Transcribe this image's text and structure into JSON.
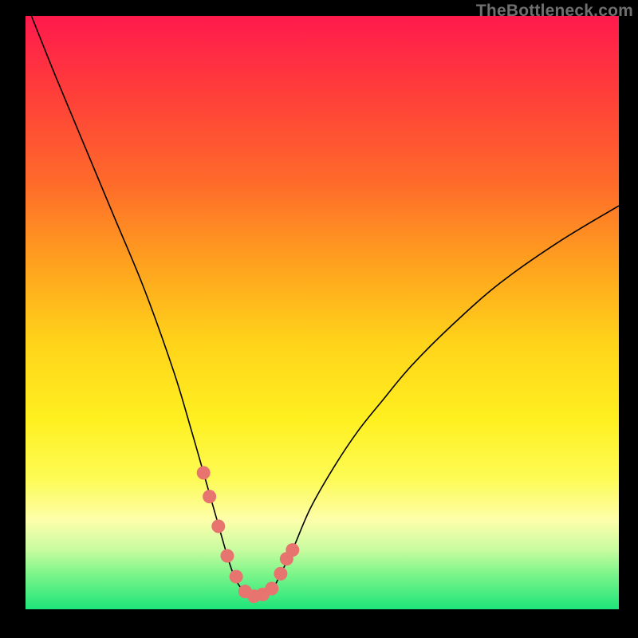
{
  "watermark": "TheBottleneck.com",
  "chart_data": {
    "type": "line",
    "title": "",
    "xlabel": "",
    "ylabel": "",
    "xlim": [
      0,
      100
    ],
    "ylim": [
      0,
      100
    ],
    "series": [
      {
        "name": "bottleneck-curve",
        "x": [
          1,
          5,
          10,
          15,
          20,
          25,
          28,
          30,
          32,
          34,
          35,
          36,
          37,
          38,
          39,
          40,
          41,
          42,
          43,
          45,
          48,
          52,
          56,
          60,
          65,
          72,
          80,
          90,
          100
        ],
        "y": [
          100,
          90,
          78,
          66,
          54,
          40,
          30,
          23,
          16,
          9,
          6,
          4,
          3,
          2,
          2,
          2,
          3,
          4,
          6,
          10,
          17,
          24,
          30,
          35,
          41,
          48,
          55,
          62,
          68
        ]
      }
    ],
    "markers": {
      "name": "highlight-dots",
      "x": [
        30,
        31,
        32.5,
        34,
        35.5,
        37,
        38.5,
        40,
        41.5,
        43,
        44,
        45
      ],
      "y": [
        23,
        19,
        14,
        9,
        5.5,
        3,
        2.2,
        2.5,
        3.5,
        6,
        8.5,
        10
      ]
    }
  }
}
